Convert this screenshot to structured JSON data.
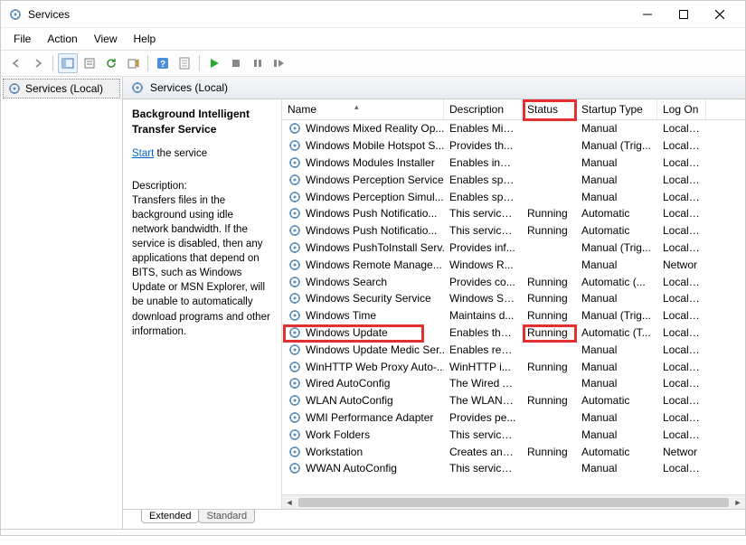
{
  "window": {
    "title": "Services"
  },
  "menu": {
    "file": "File",
    "action": "Action",
    "view": "View",
    "help": "Help"
  },
  "tree": {
    "root": "Services (Local)"
  },
  "pane_header": "Services (Local)",
  "details": {
    "title": "Background Intelligent Transfer Service",
    "start_link": "Start",
    "start_suffix": " the service",
    "desc_label": "Description:",
    "desc_text": "Transfers files in the background using idle network bandwidth. If the service is disabled, then any applications that depend on BITS, such as Windows Update or MSN Explorer, will be unable to automatically download programs and other information."
  },
  "columns": {
    "name": "Name",
    "description": "Description",
    "status": "Status",
    "startup": "Startup Type",
    "logon": "Log On"
  },
  "rows": [
    {
      "name": "Windows Mixed Reality Op...",
      "desc": "Enables Mix...",
      "status": "",
      "startup": "Manual",
      "logon": "Local Sy"
    },
    {
      "name": "Windows Mobile Hotspot S...",
      "desc": "Provides th...",
      "status": "",
      "startup": "Manual (Trig...",
      "logon": "Local Sy"
    },
    {
      "name": "Windows Modules Installer",
      "desc": "Enables inst...",
      "status": "",
      "startup": "Manual",
      "logon": "Local Sy"
    },
    {
      "name": "Windows Perception Service",
      "desc": "Enables spa...",
      "status": "",
      "startup": "Manual",
      "logon": "Local Sy"
    },
    {
      "name": "Windows Perception Simul...",
      "desc": "Enables spa...",
      "status": "",
      "startup": "Manual",
      "logon": "Local Sy"
    },
    {
      "name": "Windows Push Notificatio...",
      "desc": "This service ...",
      "status": "Running",
      "startup": "Automatic",
      "logon": "Local Sy"
    },
    {
      "name": "Windows Push Notificatio...",
      "desc": "This service ...",
      "status": "Running",
      "startup": "Automatic",
      "logon": "Local Sy"
    },
    {
      "name": "Windows PushToInstall Serv...",
      "desc": "Provides inf...",
      "status": "",
      "startup": "Manual (Trig...",
      "logon": "Local Sy"
    },
    {
      "name": "Windows Remote Manage...",
      "desc": "Windows R...",
      "status": "",
      "startup": "Manual",
      "logon": "Networ"
    },
    {
      "name": "Windows Search",
      "desc": "Provides co...",
      "status": "Running",
      "startup": "Automatic (...",
      "logon": "Local Sy"
    },
    {
      "name": "Windows Security Service",
      "desc": "Windows Se...",
      "status": "Running",
      "startup": "Manual",
      "logon": "Local Sy"
    },
    {
      "name": "Windows Time",
      "desc": "Maintains d...",
      "status": "Running",
      "startup": "Manual (Trig...",
      "logon": "Local Se"
    },
    {
      "name": "Windows Update",
      "desc": "Enables the ...",
      "status": "Running",
      "startup": "Automatic (T...",
      "logon": "Local Sy"
    },
    {
      "name": "Windows Update Medic Ser...",
      "desc": "Enables rem...",
      "status": "",
      "startup": "Manual",
      "logon": "Local Sy"
    },
    {
      "name": "WinHTTP Web Proxy Auto-...",
      "desc": "WinHTTP i...",
      "status": "Running",
      "startup": "Manual",
      "logon": "Local Se"
    },
    {
      "name": "Wired AutoConfig",
      "desc": "The Wired A...",
      "status": "",
      "startup": "Manual",
      "logon": "Local Sy"
    },
    {
      "name": "WLAN AutoConfig",
      "desc": "The WLANS...",
      "status": "Running",
      "startup": "Automatic",
      "logon": "Local Sy"
    },
    {
      "name": "WMI Performance Adapter",
      "desc": "Provides pe...",
      "status": "",
      "startup": "Manual",
      "logon": "Local Sy"
    },
    {
      "name": "Work Folders",
      "desc": "This service ...",
      "status": "",
      "startup": "Manual",
      "logon": "Local Se"
    },
    {
      "name": "Workstation",
      "desc": "Creates and...",
      "status": "Running",
      "startup": "Automatic",
      "logon": "Networ"
    },
    {
      "name": "WWAN AutoConfig",
      "desc": "This service ...",
      "status": "",
      "startup": "Manual",
      "logon": "Local Sy"
    }
  ],
  "tabs": {
    "extended": "Extended",
    "standard": "Standard"
  }
}
